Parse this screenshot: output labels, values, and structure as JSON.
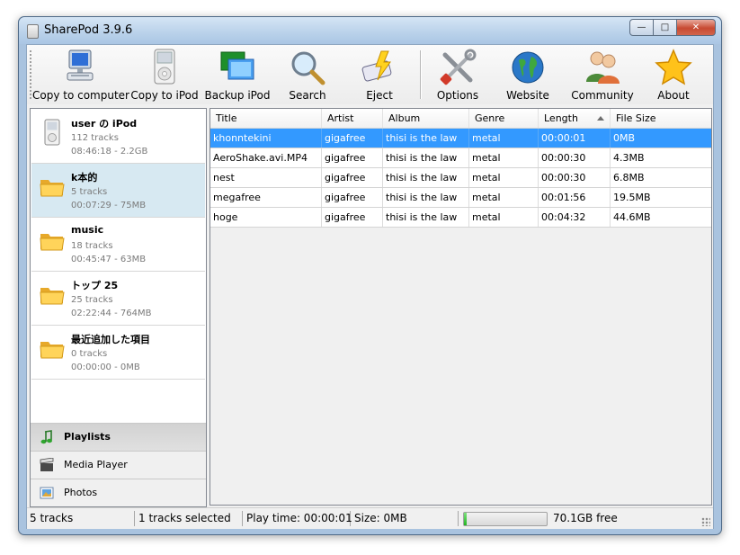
{
  "window": {
    "title": "SharePod 3.9.6"
  },
  "toolbar": {
    "buttons": [
      {
        "label": "Copy to computer",
        "icon": "computer-icon"
      },
      {
        "label": "Copy to iPod",
        "icon": "ipod-icon"
      },
      {
        "label": "Backup iPod",
        "icon": "backup-icon"
      },
      {
        "label": "Search",
        "icon": "magnifier-icon"
      },
      {
        "label": "Eject",
        "icon": "eject-icon"
      },
      {
        "label": "Options",
        "icon": "tools-icon"
      },
      {
        "label": "Website",
        "icon": "globe-icon"
      },
      {
        "label": "Community",
        "icon": "people-icon"
      },
      {
        "label": "About",
        "icon": "star-icon"
      }
    ]
  },
  "playlists": [
    {
      "name": "user の iPod",
      "tracks": "112 tracks",
      "info": "08:46:18 - 2.2GB",
      "icon": "ipod-icon"
    },
    {
      "name": "k本的",
      "tracks": "5 tracks",
      "info": "00:07:29 - 75MB",
      "icon": "folder-icon"
    },
    {
      "name": "music",
      "tracks": "18 tracks",
      "info": "00:45:47 - 63MB",
      "icon": "folder-icon"
    },
    {
      "name": "トップ 25",
      "tracks": "25 tracks",
      "info": "02:22:44 - 764MB",
      "icon": "folder-icon"
    },
    {
      "name": "最近追加した項目",
      "tracks": "0 tracks",
      "info": "00:00:00 - 0MB",
      "icon": "folder-icon"
    }
  ],
  "nav": [
    {
      "label": "Playlists",
      "icon": "music-note-icon"
    },
    {
      "label": "Media Player",
      "icon": "clapper-icon"
    },
    {
      "label": "Photos",
      "icon": "photo-icon"
    }
  ],
  "table": {
    "columns": [
      "Title",
      "Artist",
      "Album",
      "Genre",
      "Length",
      "File Size"
    ],
    "rows": [
      [
        "khonntekini",
        "gigafree",
        "thisi is the law",
        "metal",
        "00:00:01",
        "0MB"
      ],
      [
        "AeroShake.avi.MP4",
        "gigafree",
        "thisi is the law",
        "metal",
        "00:00:30",
        "4.3MB"
      ],
      [
        "nest",
        "gigafree",
        "thisi is the law",
        "metal",
        "00:00:30",
        "6.8MB"
      ],
      [
        "megafree",
        "gigafree",
        "thisi is the law",
        "metal",
        "00:01:56",
        "19.5MB"
      ],
      [
        "hoge",
        "gigafree",
        "thisi is the law",
        "metal",
        "00:04:32",
        "44.6MB"
      ]
    ]
  },
  "status": {
    "tracks": "5 tracks",
    "selected": "1 tracks selected",
    "playtime": "Play time: 00:00:01",
    "size": "Size: 0MB",
    "free": "70.1GB free",
    "storage_used_fraction": 0.03
  },
  "colors": {
    "selection": "#3399ff",
    "selected_playlist": "#d7e9f2",
    "progress": "#22b522"
  }
}
